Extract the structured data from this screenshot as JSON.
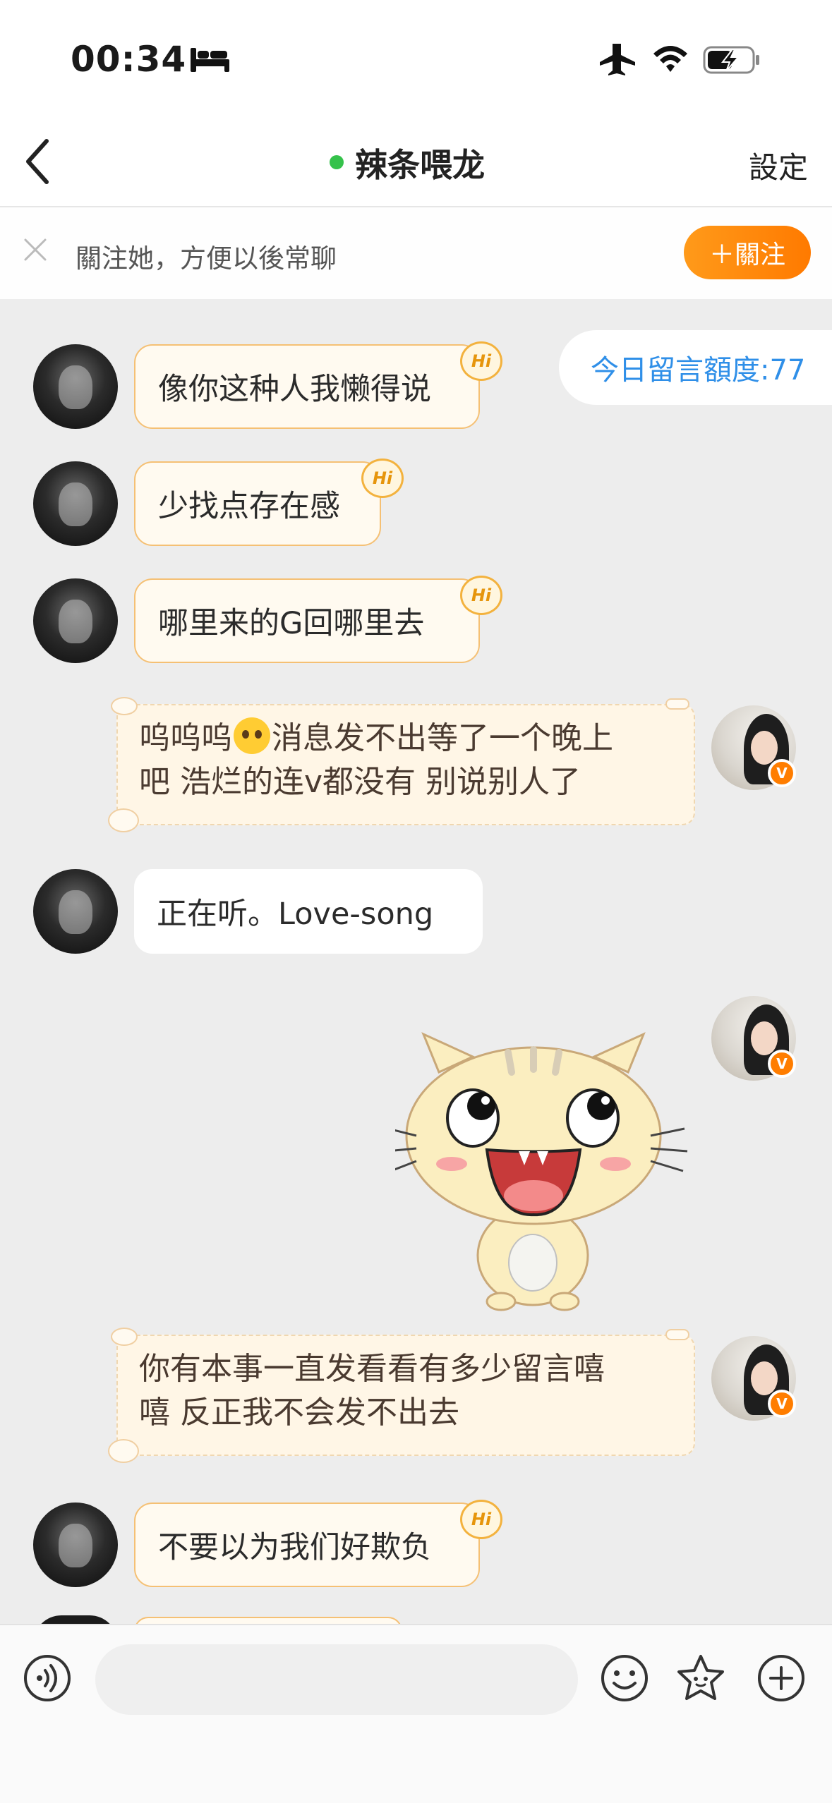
{
  "status_bar": {
    "time": "00:34"
  },
  "nav": {
    "title": "辣条喂龙",
    "settings": "設定"
  },
  "follow_banner": {
    "text": "關注她，方便以後常聊",
    "button": "＋關注"
  },
  "quota": {
    "text": "今日留言額度:77"
  },
  "messages": [
    {
      "side": "left",
      "text": "像你这种人我懒得说",
      "badge": "Hi"
    },
    {
      "side": "left",
      "text": "少找点存在感",
      "badge": "Hi"
    },
    {
      "side": "left",
      "text": "哪里来的G回哪里去",
      "badge": "Hi"
    },
    {
      "side": "right",
      "line1_pre": "呜呜呜",
      "line1_post": "消息发不出等了一个晚上",
      "line2": "吧 浩烂的连v都没有 别说别人了"
    },
    {
      "side": "left",
      "text": "正在听。Love-song"
    },
    {
      "side": "right",
      "sticker": "cat-sticker"
    },
    {
      "side": "right",
      "line1": "你有本事一直发看看有多少留言嘻",
      "line2": "嘻 反正我不会发不出去"
    },
    {
      "side": "left",
      "text": "不要以为我们好欺负",
      "badge": "Hi"
    }
  ],
  "verified_badge": "V",
  "icons": [
    "bed-icon",
    "airplane-icon",
    "wifi-icon",
    "battery-charging-icon",
    "back-icon",
    "close-icon",
    "voice-icon",
    "emoji-icon",
    "sticker-icon",
    "plus-icon"
  ],
  "colors": {
    "accent_orange": "#ff7a00",
    "online_green": "#35c24b",
    "quota_blue": "#2f8fe8"
  }
}
